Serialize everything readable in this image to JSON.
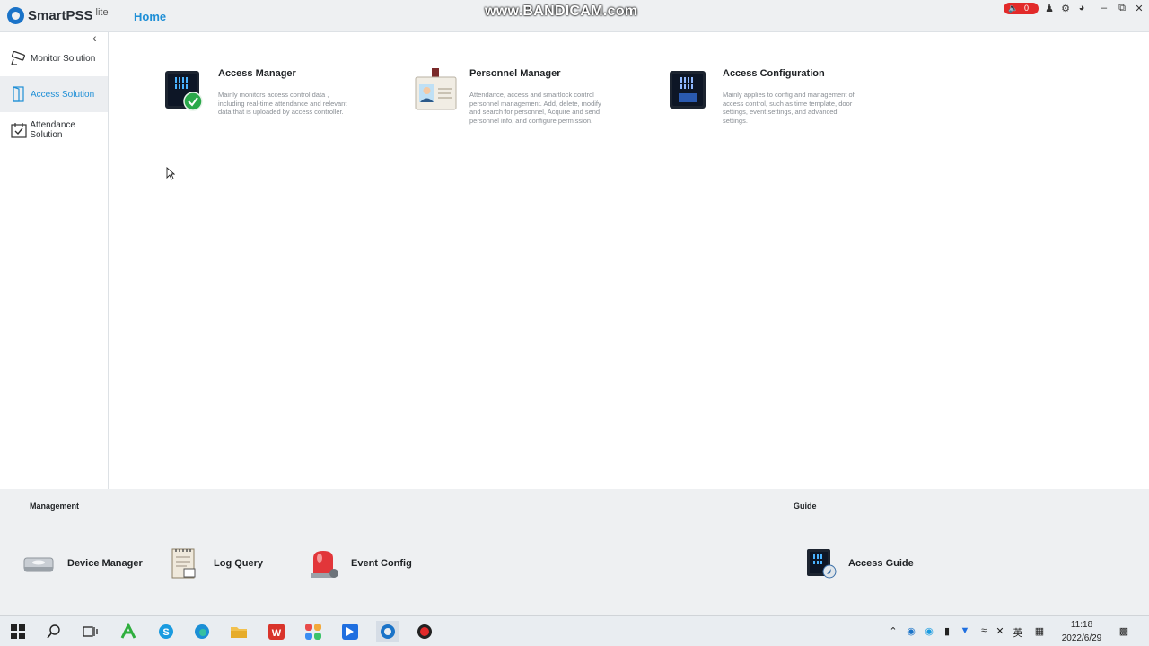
{
  "app": {
    "name": "SmartPSS",
    "edition": "lite",
    "home_tab": "Home",
    "watermark": "www.BANDICAM.com",
    "alarm_count": "0"
  },
  "sidebar": {
    "items": [
      {
        "label": "Monitor Solution",
        "icon": "cctv-camera-icon",
        "active": false
      },
      {
        "label": "Access Solution",
        "icon": "door-icon",
        "active": true
      },
      {
        "label": "Attendance Solution",
        "icon": "calendar-check-icon",
        "active": false
      }
    ]
  },
  "modules": [
    {
      "title": "Access Manager",
      "desc": "Mainly monitors access control data , including real-time attendance and relevant data that is uploaded by access controller."
    },
    {
      "title": "Personnel Manager",
      "desc": "Attendance,  access and smartlock control personnel management.  Add, delete, modify and search for personnel, Acquire and send personnel info, and configure permission."
    },
    {
      "title": "Access Configuration",
      "desc": "Mainly applies to config and management of access control, such as time template, door settings, event settings, and advanced settings."
    }
  ],
  "management": {
    "title": "Management",
    "items": [
      {
        "label": "Device Manager",
        "icon": "device-icon"
      },
      {
        "label": "Log Query",
        "icon": "log-notepad-icon"
      },
      {
        "label": "Event Config",
        "icon": "alarm-siren-icon"
      }
    ]
  },
  "guide": {
    "title": "Guide",
    "items": [
      {
        "label": "Access Guide",
        "icon": "access-guide-icon"
      }
    ]
  },
  "taskbar": {
    "time": "11:18",
    "date": "2022/6/29",
    "ime": "英"
  },
  "colors": {
    "accent": "#1f8fd6",
    "alarm": "#e22a2a",
    "bottom_bg": "#eef0f2"
  }
}
